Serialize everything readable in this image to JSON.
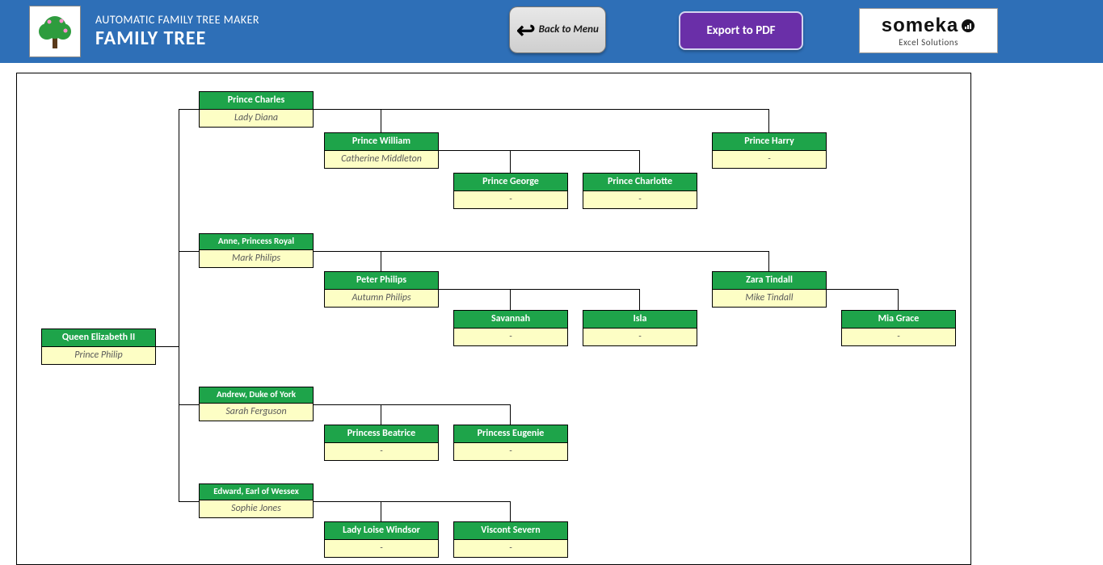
{
  "header": {
    "subtitle": "AUTOMATIC FAMILY TREE MAKER",
    "title": "FAMILY TREE",
    "back_button": "Back to Menu",
    "export_button": "Export to PDF",
    "brand_name": "someka",
    "brand_tag": "Excel Solutions"
  },
  "nodes": {
    "root": {
      "name": "Queen Elizabeth II",
      "spouse": "Prince Philip"
    },
    "c1": {
      "name": "Prince Charles",
      "spouse": "Lady Diana"
    },
    "c1g1": {
      "name": "Prince William",
      "spouse": "Catherine Middleton"
    },
    "c1g1a": {
      "name": "Prince George",
      "spouse": "-"
    },
    "c1g1b": {
      "name": "Prince Charlotte",
      "spouse": "-"
    },
    "c1g2": {
      "name": "Prince Harry",
      "spouse": "-"
    },
    "c2": {
      "name": "Anne, Princess Royal",
      "spouse": "Mark Philips"
    },
    "c2g1": {
      "name": "Peter Philips",
      "spouse": "Autumn Philips"
    },
    "c2g1a": {
      "name": "Savannah",
      "spouse": "-"
    },
    "c2g1b": {
      "name": "Isla",
      "spouse": "-"
    },
    "c2g2": {
      "name": "Zara Tindall",
      "spouse": "Mike Tindall"
    },
    "c2g2a": {
      "name": "Mia Grace",
      "spouse": "-"
    },
    "c3": {
      "name": "Andrew, Duke of York",
      "spouse": "Sarah Ferguson"
    },
    "c3g1": {
      "name": "Princess Beatrice",
      "spouse": "-"
    },
    "c3g2": {
      "name": "Princess Eugenie",
      "spouse": "-"
    },
    "c4": {
      "name": "Edward, Earl of Wessex",
      "spouse": "Sophie Jones"
    },
    "c4g1": {
      "name": "Lady Loise Windsor",
      "spouse": "-"
    },
    "c4g2": {
      "name": "Viscont Severn",
      "spouse": "-"
    }
  }
}
